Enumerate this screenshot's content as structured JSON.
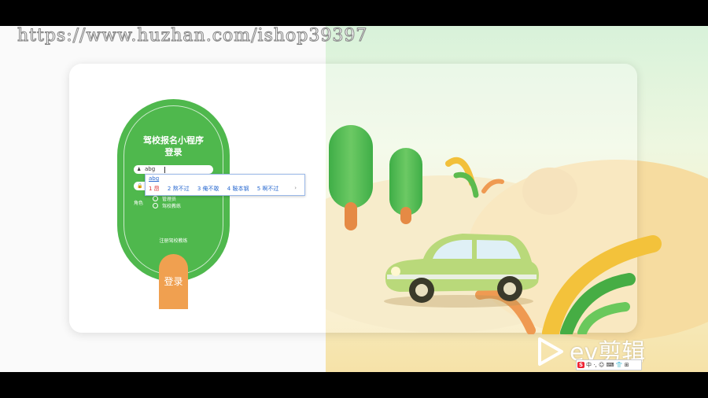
{
  "watermark": "https://www.huzhan.com/ishop39397",
  "app": {
    "title_line1": "驾校报名小程序",
    "title_line2": "登录"
  },
  "form": {
    "username_value": "abg",
    "password_value": "",
    "role_label": "角色",
    "roles": [
      "管理员",
      "驾校教练"
    ],
    "register_link": "注册驾校教练",
    "login_label": "登录"
  },
  "ime": {
    "composition": "abg",
    "candidates": [
      "1 昂",
      "2 熬不过",
      "3 俺不敢",
      "4 鞍本钢",
      "5 啊不过"
    ],
    "next": "›"
  },
  "ime_toolbar": {
    "brand": "S",
    "items": "中 ·, ☺ ⌨ 👕 ⊞"
  },
  "ev_logo": "ev剪辑",
  "colors": {
    "form_green": "#4fb84d",
    "button_orange": "#f0a050",
    "ime_blue": "#2a6ad0"
  }
}
